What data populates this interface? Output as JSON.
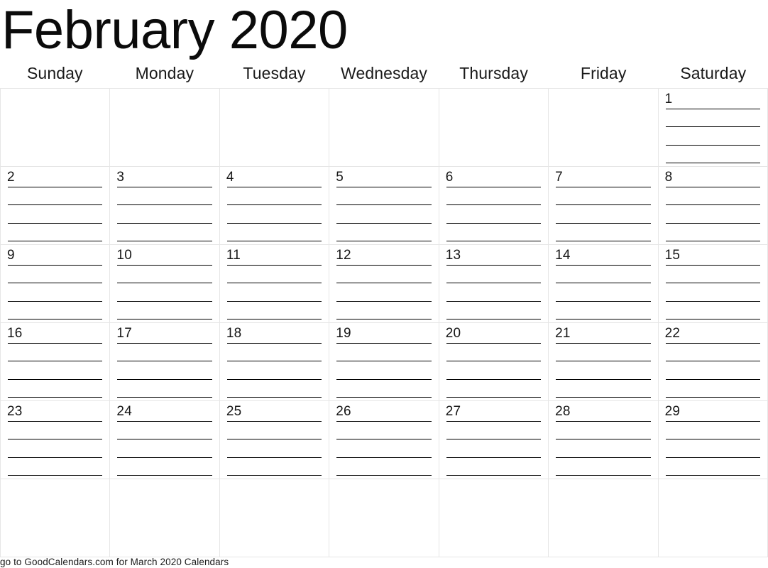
{
  "calendar": {
    "title": "February 2020",
    "month": "February",
    "year": "2020",
    "weekdays": [
      "Sunday",
      "Monday",
      "Tuesday",
      "Wednesday",
      "Thursday",
      "Friday",
      "Saturday"
    ],
    "lines_per_day": 4,
    "weeks": [
      [
        "",
        "",
        "",
        "",
        "",
        "",
        "1"
      ],
      [
        "2",
        "3",
        "4",
        "5",
        "6",
        "7",
        "8"
      ],
      [
        "9",
        "10",
        "11",
        "12",
        "13",
        "14",
        "15"
      ],
      [
        "16",
        "17",
        "18",
        "19",
        "20",
        "21",
        "22"
      ],
      [
        "23",
        "24",
        "25",
        "26",
        "27",
        "28",
        "29"
      ],
      [
        "",
        "",
        "",
        "",
        "",
        "",
        ""
      ]
    ],
    "colors": {
      "text": "#0b0b0b",
      "grid_border": "#e6e6e6",
      "rule_line": "#000000",
      "background": "#ffffff"
    }
  },
  "footer": {
    "text": "go to GoodCalendars.com for March 2020 Calendars"
  }
}
